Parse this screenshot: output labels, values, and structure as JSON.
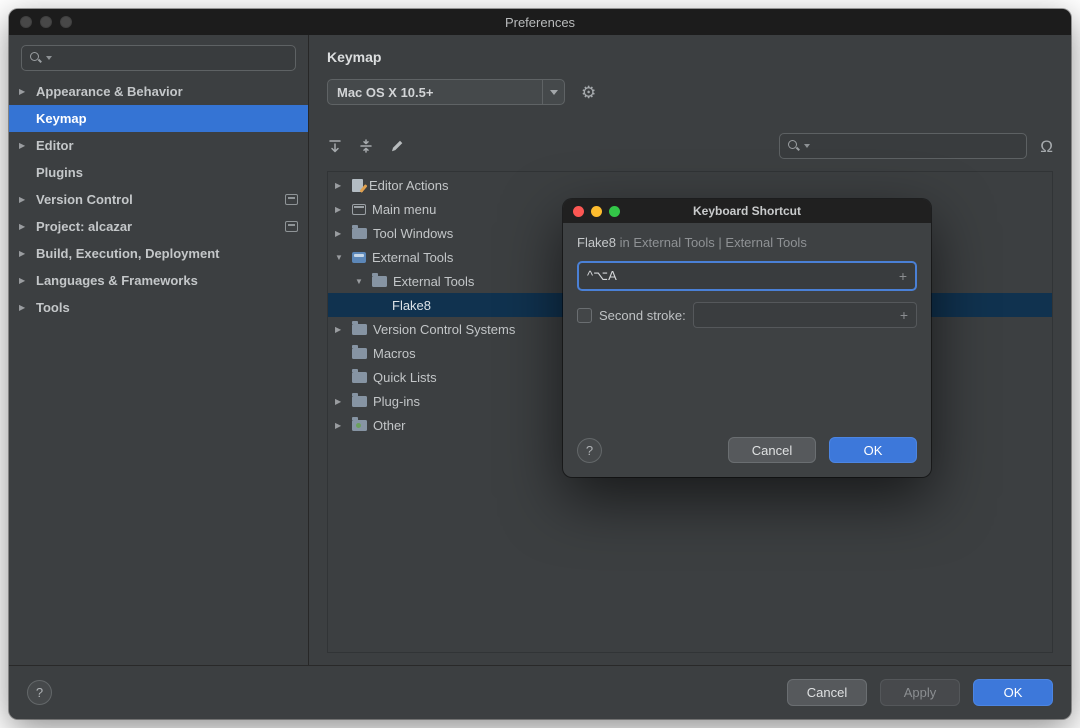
{
  "window": {
    "title": "Preferences"
  },
  "sidebar": {
    "items": [
      {
        "label": "Appearance & Behavior"
      },
      {
        "label": "Keymap"
      },
      {
        "label": "Editor"
      },
      {
        "label": "Plugins"
      },
      {
        "label": "Version Control"
      },
      {
        "label": "Project: alcazar"
      },
      {
        "label": "Build, Execution, Deployment"
      },
      {
        "label": "Languages & Frameworks"
      },
      {
        "label": "Tools"
      }
    ]
  },
  "main": {
    "title": "Keymap",
    "scheme": "Mac OS X 10.5+",
    "tree": [
      {
        "label": "Editor Actions"
      },
      {
        "label": "Main menu"
      },
      {
        "label": "Tool Windows"
      },
      {
        "label": "External Tools"
      },
      {
        "label": "External Tools"
      },
      {
        "label": "Flake8"
      },
      {
        "label": "Version Control Systems"
      },
      {
        "label": "Macros"
      },
      {
        "label": "Quick Lists"
      },
      {
        "label": "Plug-ins"
      },
      {
        "label": "Other"
      }
    ]
  },
  "dialog": {
    "title": "Keyboard Shortcut",
    "action_name": "Flake8",
    "action_context": "in External Tools | External Tools",
    "first_stroke": "^⌥A",
    "add_symbol": "+",
    "second_stroke_label": "Second stroke:",
    "help": "?",
    "cancel": "Cancel",
    "ok": "OK"
  },
  "footer": {
    "help": "?",
    "cancel": "Cancel",
    "apply": "Apply",
    "ok": "OK"
  },
  "colors": {
    "accent_blue": "#3574d4",
    "selection_inactive": "#10324f",
    "traffic_red": "#fc5753",
    "traffic_yellow": "#fdbc2e",
    "traffic_green": "#33c748"
  }
}
